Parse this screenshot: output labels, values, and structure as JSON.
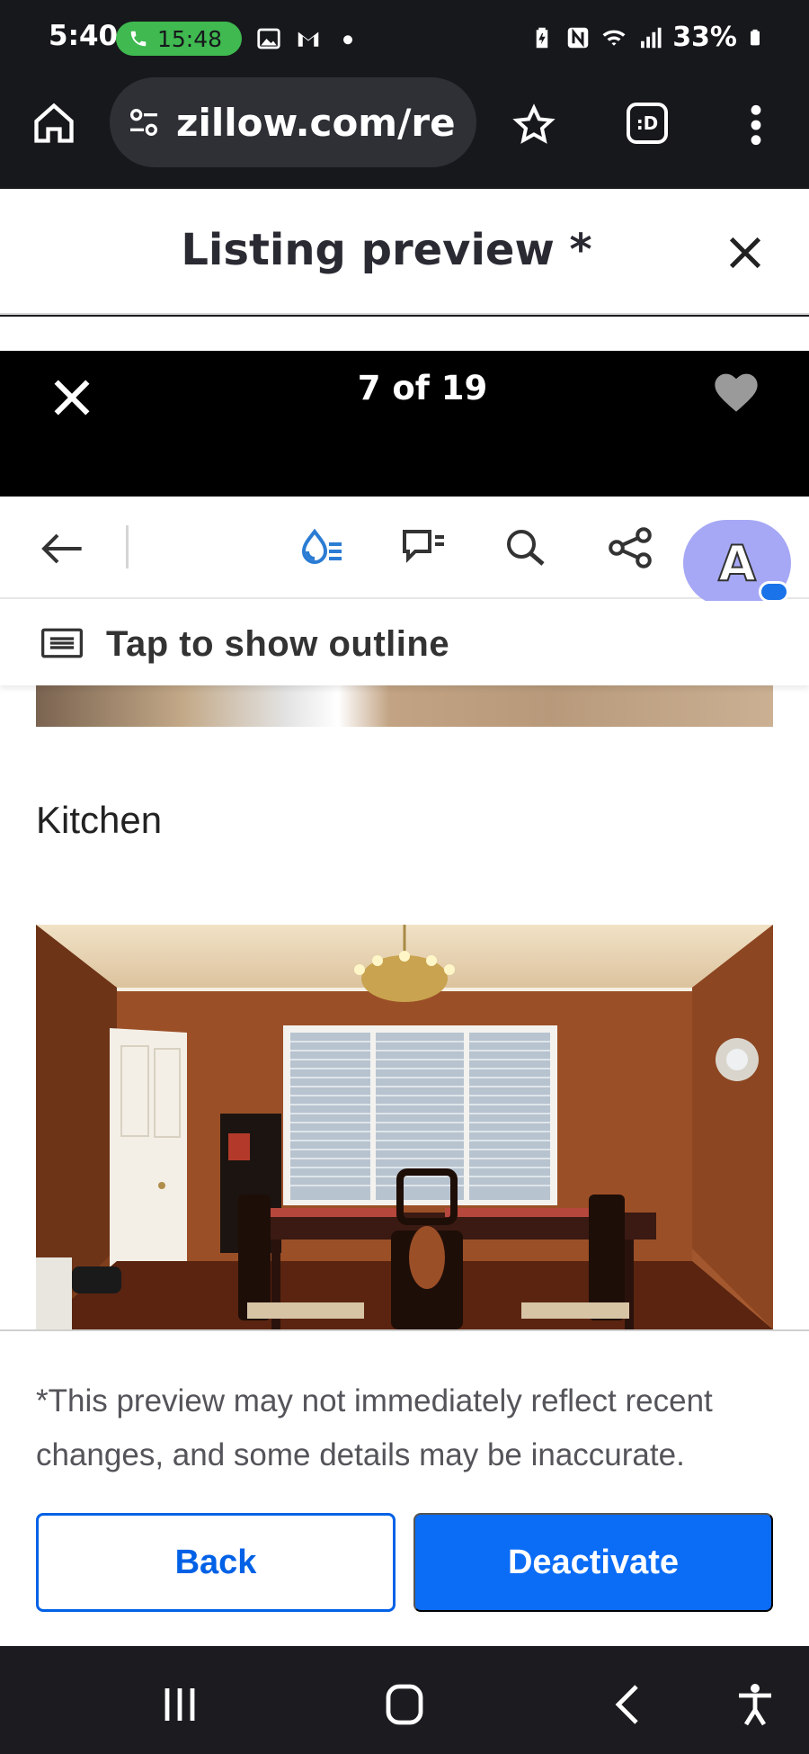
{
  "status_bar": {
    "time": "5:40",
    "call_timer": "15:48",
    "battery": "33%",
    "icons_left": [
      "gallery-icon",
      "gmail-icon",
      "dot-icon"
    ],
    "icons_right": [
      "battery-saver-icon",
      "nfc-icon",
      "wifi-icon",
      "signal-icon",
      "battery-icon"
    ]
  },
  "browser": {
    "url": "zillow.com/re",
    "tab_badge": ":D"
  },
  "preview": {
    "title": "Listing preview *"
  },
  "gallery": {
    "counter": "7 of 19"
  },
  "photo": {
    "outline_label": "Tap to show outline",
    "heading": "Kitchen",
    "avatar_letter": "A"
  },
  "bottom": {
    "disclaimer": "*This preview may not immediately reflect recent changes, and some details may be inaccurate.",
    "back_label": "Back",
    "deactivate_label": "Deactivate"
  },
  "colors": {
    "primary": "#0b6cf5",
    "call_green": "#3fb950",
    "avatar": "#a6a8f5"
  }
}
